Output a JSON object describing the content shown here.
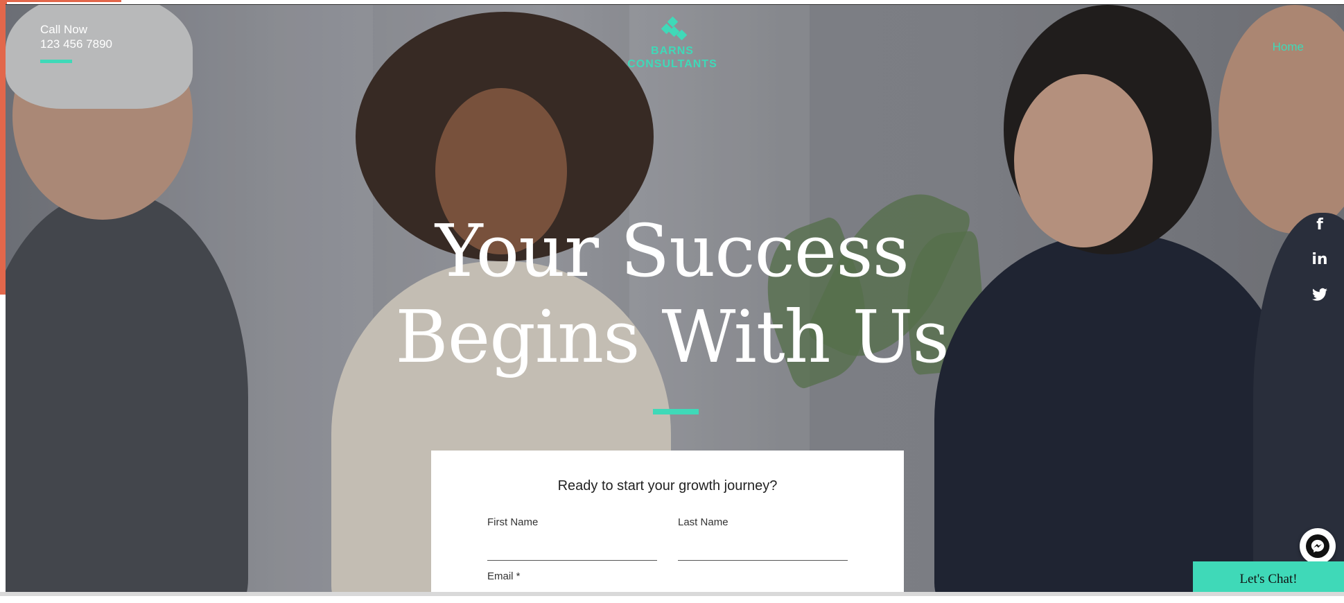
{
  "header": {
    "call_label": "Call Now",
    "phone": "123 456 7890",
    "logo_line1": "BARNS",
    "logo_line2": "CONSULTANTS",
    "nav_home": "Home"
  },
  "hero": {
    "headline_line1": "Your Success",
    "headline_line2": "Begins With Us"
  },
  "form": {
    "title": "Ready to start your growth journey?",
    "first_name_label": "First Name",
    "last_name_label": "Last Name",
    "email_label": "Email *"
  },
  "social": {
    "facebook_glyph": "f",
    "linkedin_glyph": "in"
  },
  "chat": {
    "button_label": "Let's Chat!"
  },
  "colors": {
    "accent": "#3fd9b8",
    "side_strip": "#e2674b"
  }
}
